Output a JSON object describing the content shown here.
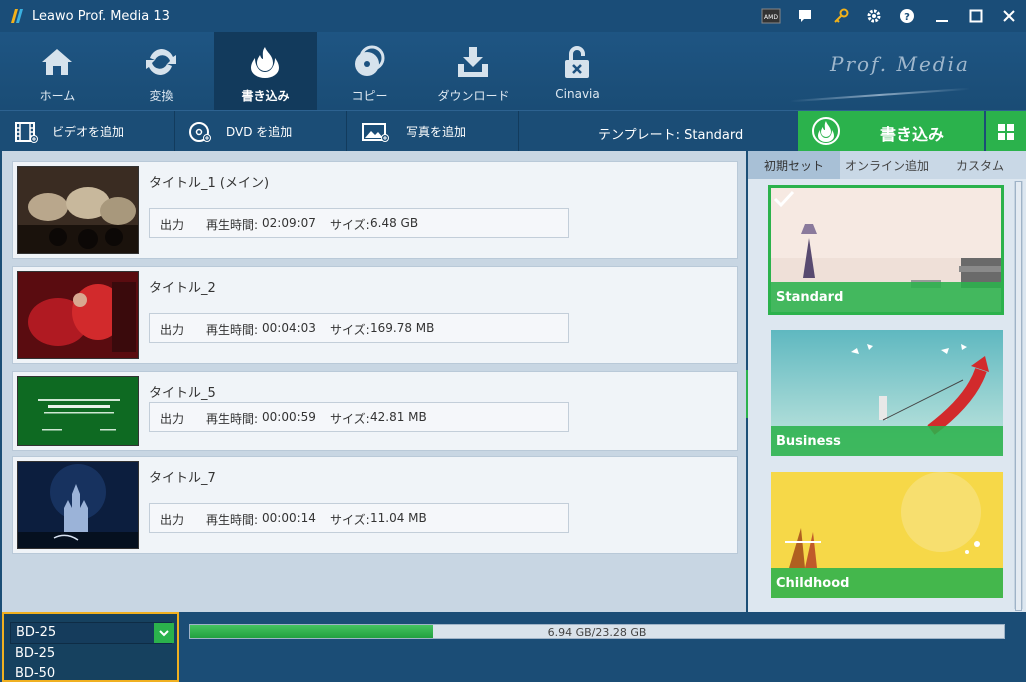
{
  "window": {
    "title": "Leawo Prof. Media 13",
    "icons": [
      "amd-icon",
      "chat-icon",
      "key-icon",
      "gear-icon",
      "help-icon",
      "minimize-icon",
      "maximize-icon",
      "close-icon"
    ]
  },
  "nav": {
    "items": [
      {
        "label": "ホーム",
        "icon": "home-icon"
      },
      {
        "label": "変換",
        "icon": "convert-icon"
      },
      {
        "label": "書き込み",
        "icon": "burn-icon",
        "active": true
      },
      {
        "label": "コピー",
        "icon": "copy-icon"
      },
      {
        "label": "ダウンロード",
        "icon": "download-icon"
      },
      {
        "label": "Cinavia",
        "icon": "cinavia-icon"
      }
    ],
    "brand": "Prof. Media"
  },
  "toolbar": {
    "add_video": "ビデオを追加",
    "add_dvd": "DVD を追加",
    "add_photo": "写真を追加",
    "template": "テンプレート: Standard",
    "burn": "書き込み"
  },
  "titles": [
    {
      "name": "タイトル_1 (メイン)",
      "output": "出力",
      "duration_label": "再生時間:",
      "duration": "02:09:07",
      "size_label": "サイズ:",
      "size": "6.48 GB"
    },
    {
      "name": "タイトル_2",
      "output": "出力",
      "duration_label": "再生時間:",
      "duration": "00:04:03",
      "size_label": "サイズ:",
      "size": "169.78 MB"
    },
    {
      "name": "タイトル_5",
      "output": "出力",
      "duration_label": "再生時間:",
      "duration": "00:00:59",
      "size_label": "サイズ:",
      "size": "42.81 MB"
    },
    {
      "name": "タイトル_7",
      "output": "出力",
      "duration_label": "再生時間:",
      "duration": "00:00:14",
      "size_label": "サイズ:",
      "size": "11.04 MB"
    }
  ],
  "templates": {
    "tabs": [
      "初期セット",
      "オンライン追加",
      "カスタム"
    ],
    "items": [
      {
        "name": "Standard",
        "selected": true
      },
      {
        "name": "Business"
      },
      {
        "name": "Childhood"
      }
    ]
  },
  "disc": {
    "selected": "BD-25",
    "options": [
      "BD-25",
      "BD-50"
    ]
  },
  "usage": {
    "text": "6.94 GB/23.28 GB",
    "fraction": 0.298
  },
  "colors": {
    "accent_green": "#2bb24c",
    "header_blue": "#1a4d78",
    "focus_yellow": "#f0b020"
  }
}
